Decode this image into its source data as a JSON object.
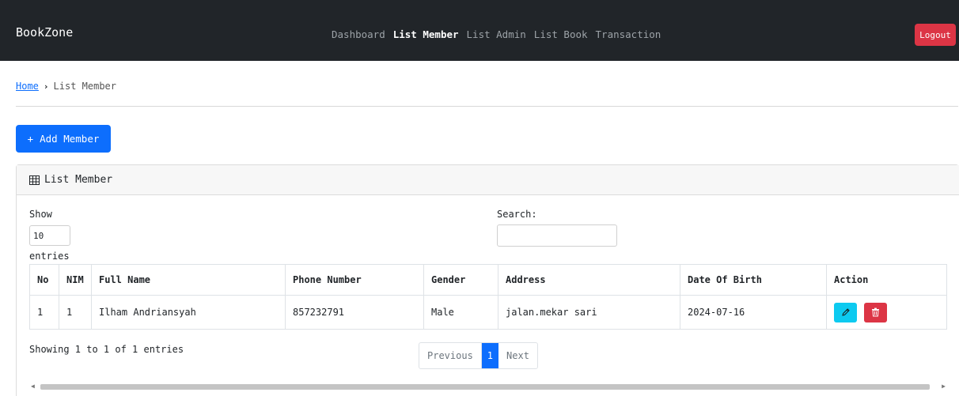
{
  "navbar": {
    "brand": "BookZone",
    "links": [
      "Dashboard",
      "List Member",
      "List Admin",
      "List Book",
      "Transaction"
    ],
    "active_link": "List Member",
    "logout_label": "Logout"
  },
  "breadcrumb": {
    "home": "Home",
    "current": "List Member"
  },
  "add_button_label": "Add Member",
  "card": {
    "title": "List Member",
    "show_label": "Show",
    "length_value": "10",
    "entries_label": "entries",
    "search_label": "Search:",
    "search_value": "",
    "columns": [
      "No",
      "NIM",
      "Full Name",
      "Phone Number",
      "Gender",
      "Address",
      "Date Of Birth",
      "Action"
    ],
    "rows": [
      {
        "no": "1",
        "nim": "1",
        "full_name": "Ilham Andriansyah",
        "phone": "857232791",
        "gender": "Male",
        "address": "jalan.mekar sari",
        "dob": "2024-07-16"
      }
    ],
    "info": "Showing 1 to 1 of 1 entries",
    "pagination": {
      "previous": "Previous",
      "current": "1",
      "next": "Next"
    }
  },
  "colors": {
    "navbar_bg": "#212529",
    "primary": "#0d6efd",
    "danger": "#dc3545",
    "info": "#0dcaf0"
  },
  "icons": {
    "add": "plus-icon",
    "card": "table-grid-icon",
    "edit": "pencil-icon",
    "delete": "trash-icon",
    "breadcrumb_sep": "chevron-right-icon"
  }
}
